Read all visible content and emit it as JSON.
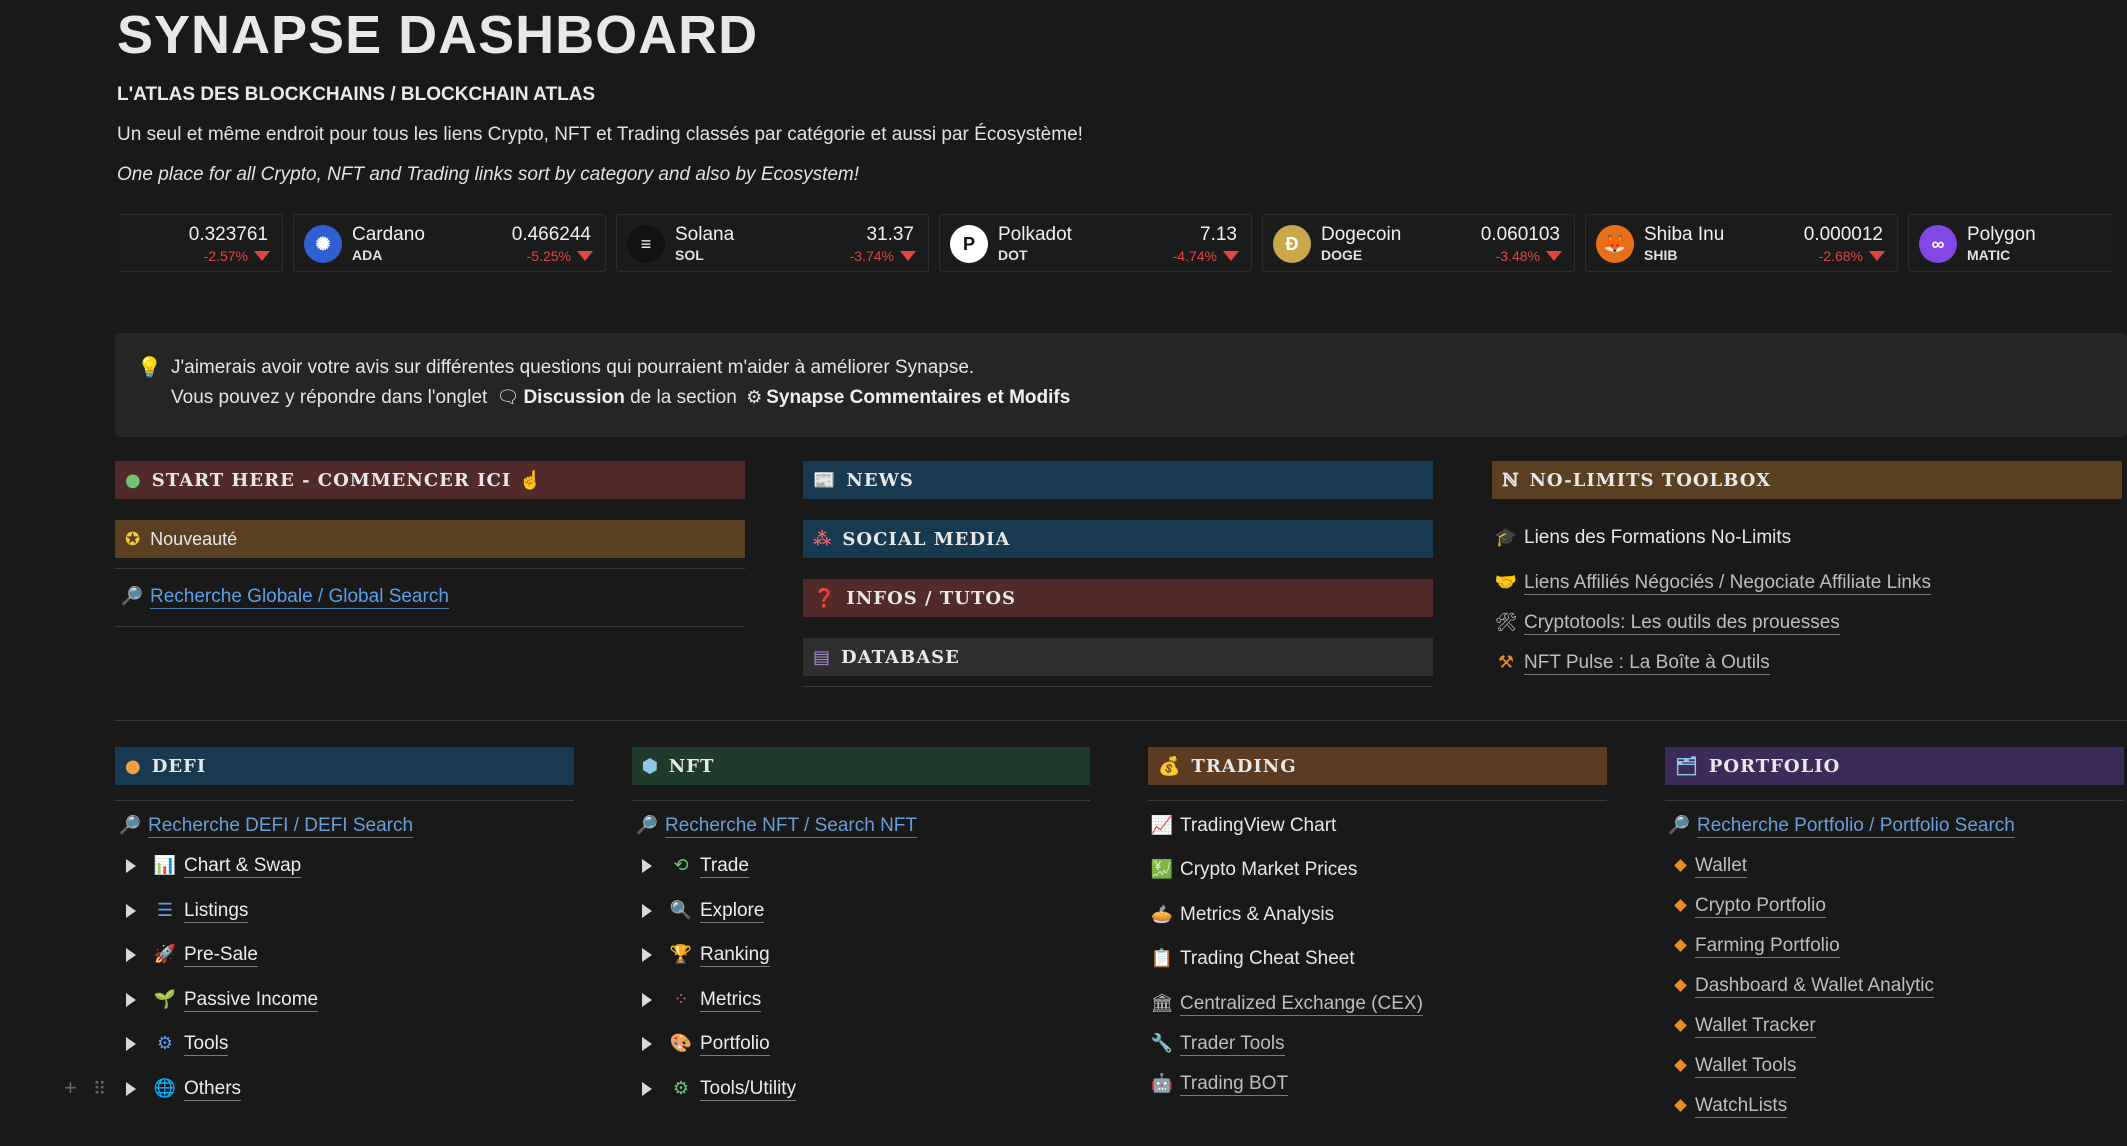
{
  "page": {
    "title": "SYNAPSE DASHBOARD",
    "subtitle": "L'ATLAS DES BLOCKCHAINS / BLOCKCHAIN ATLAS",
    "desc_fr": "Un seul et même endroit pour tous les liens Crypto, NFT et Trading classés par catégorie et aussi par Écosystème!",
    "desc_en": "One place for all Crypto, NFT and Trading links sort by category and also by Ecosystem!"
  },
  "ticker": [
    {
      "name": "",
      "symbol": "",
      "price": "0.323761",
      "change": "-2.57%",
      "color": "#1b1b1b",
      "glyph": ""
    },
    {
      "name": "Cardano",
      "symbol": "ADA",
      "price": "0.466244",
      "change": "-5.25%",
      "color": "#2f5fd0",
      "glyph": "✺"
    },
    {
      "name": "Solana",
      "symbol": "SOL",
      "price": "31.37",
      "change": "-3.74%",
      "color": "#111111",
      "glyph": "≡"
    },
    {
      "name": "Polkadot",
      "symbol": "DOT",
      "price": "7.13",
      "change": "-4.74%",
      "color": "#ffffff",
      "glyph": "P"
    },
    {
      "name": "Dogecoin",
      "symbol": "DOGE",
      "price": "0.060103",
      "change": "-3.48%",
      "color": "#c9a74a",
      "glyph": "Ð"
    },
    {
      "name": "Shiba Inu",
      "symbol": "SHIB",
      "price": "0.000012",
      "change": "-2.68%",
      "color": "#e8701a",
      "glyph": "🦊"
    },
    {
      "name": "Polygon",
      "symbol": "MATIC",
      "price": "",
      "change": "",
      "color": "#8247e5",
      "glyph": "∞"
    }
  ],
  "callout": {
    "line1": "J'aimerais avoir votre avis sur différentes questions qui pourraient m'aider à améliorer Synapse.",
    "line2_prefix": "Vous pouvez y répondre dans l'onglet",
    "discussion": "Discussion",
    "line2_mid": "de la section",
    "section": "Synapse Commentaires et Modifs"
  },
  "top_left": {
    "start_here": "START HERE - COMMENCER ICI",
    "nouveaute": "Nouveauté",
    "global_search": "Recherche Globale / Global Search"
  },
  "top_mid": {
    "news": "NEWS",
    "social": "SOCIAL MEDIA",
    "infos": "INFOS / TUTOS",
    "database": "DATABASE"
  },
  "top_right": {
    "toolbox": "NO-LIMITS TOOLBOX",
    "links": [
      "Liens des Formations No-Limits",
      "Liens Affiliés Négociés / Negociate Affiliate Links",
      "Cryptotools: Les outils des prouesses",
      "NFT Pulse : La Boîte à Outils"
    ]
  },
  "defi": {
    "header": "DEFI",
    "search": "Recherche DEFI / DEFI Search",
    "items": [
      "Chart & Swap",
      "Listings",
      "Pre-Sale",
      "Passive Income",
      "Tools",
      "Others"
    ]
  },
  "nft": {
    "header": "NFT",
    "search": "Recherche NFT / Search NFT",
    "items": [
      "Trade",
      "Explore",
      "Ranking",
      "Metrics",
      "Portfolio",
      "Tools/Utility"
    ]
  },
  "trading": {
    "header": "TRADING",
    "items": [
      "TradingView Chart",
      "Crypto Market Prices",
      "Metrics & Analysis",
      "Trading Cheat Sheet",
      "Centralized Exchange (CEX)",
      "Trader Tools",
      "Trading BOT"
    ]
  },
  "portfolio": {
    "header": "PORTFOLIO",
    "search": "Recherche Portfolio / Portfolio Search",
    "items": [
      "Wallet",
      "Crypto Portfolio",
      "Farming Portfolio",
      "Dashboard & Wallet Analytic",
      "Wallet Tracker",
      "Wallet Tools",
      "WatchLists"
    ]
  }
}
